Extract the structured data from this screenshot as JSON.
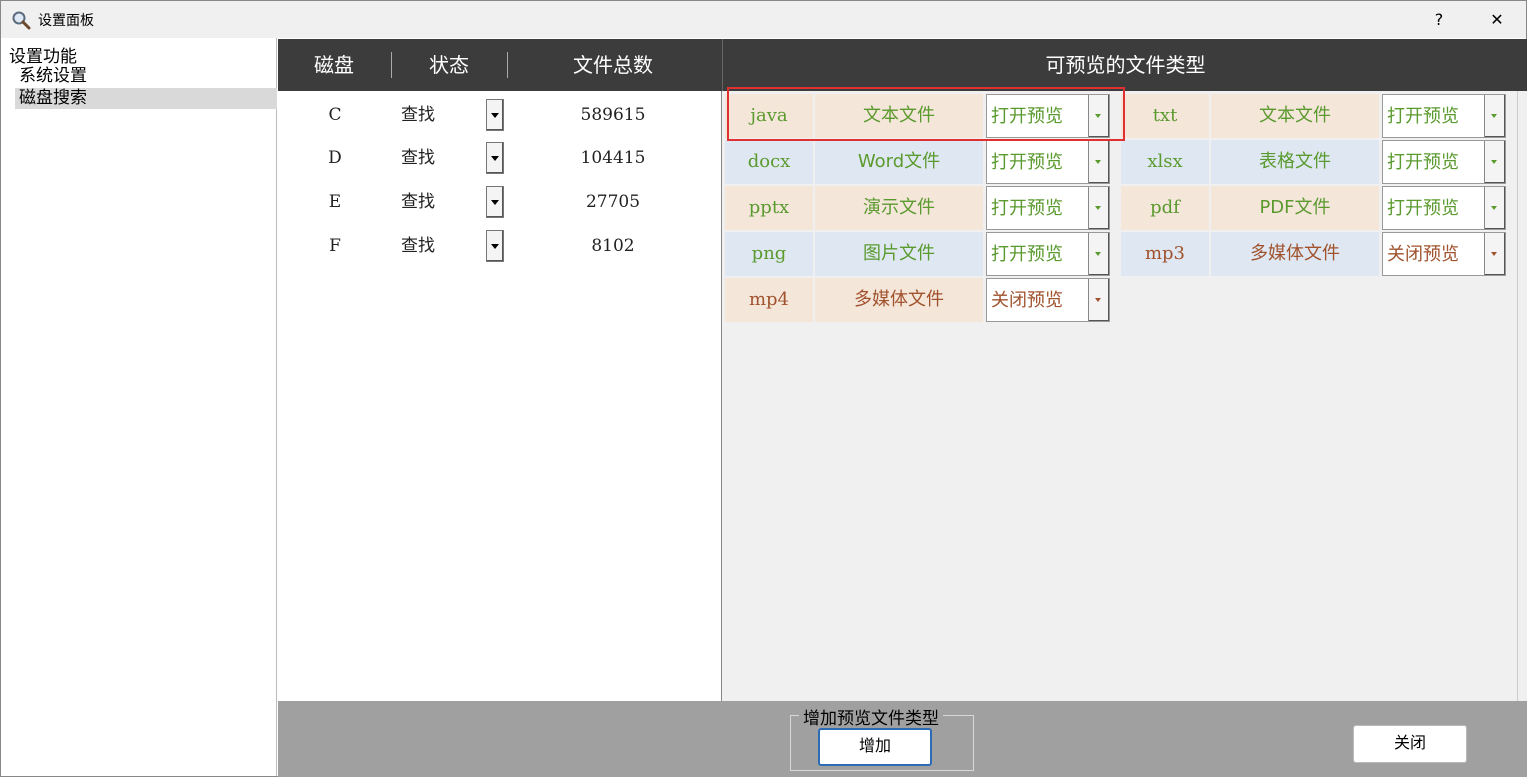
{
  "window": {
    "title": "设置面板",
    "help": "?",
    "close": "✕"
  },
  "sidebar": {
    "root": "设置功能",
    "items": [
      {
        "label": "系统设置",
        "selected": false
      },
      {
        "label": "磁盘搜索",
        "selected": true
      }
    ]
  },
  "disk_table": {
    "headers": [
      "磁盘",
      "状态",
      "文件总数"
    ],
    "rows": [
      {
        "disk": "C",
        "status": "查找",
        "count": "589615"
      },
      {
        "disk": "D",
        "status": "查找",
        "count": "104415"
      },
      {
        "disk": "E",
        "status": "查找",
        "count": "27705"
      },
      {
        "disk": "F",
        "status": "查找",
        "count": "8102"
      }
    ]
  },
  "types_panel": {
    "header": "可预览的文件类型",
    "items": [
      {
        "ext": "java",
        "desc": "文本文件",
        "state": "打开预览",
        "color": "#5a9a2e",
        "bg": "#f5e6da"
      },
      {
        "ext": "txt",
        "desc": "文本文件",
        "state": "打开预览",
        "color": "#5a9a2e",
        "bg": "#f5e6da"
      },
      {
        "ext": "docx",
        "desc": "Word文件",
        "state": "打开预览",
        "color": "#5a9a2e",
        "bg": "#dfe8f2"
      },
      {
        "ext": "xlsx",
        "desc": "表格文件",
        "state": "打开预览",
        "color": "#5a9a2e",
        "bg": "#dfe8f2"
      },
      {
        "ext": "pptx",
        "desc": "演示文件",
        "state": "打开预览",
        "color": "#5a9a2e",
        "bg": "#f5e6da"
      },
      {
        "ext": "pdf",
        "desc": "PDF文件",
        "state": "打开预览",
        "color": "#5a9a2e",
        "bg": "#f5e6da"
      },
      {
        "ext": "png",
        "desc": "图片文件",
        "state": "打开预览",
        "color": "#5a9a2e",
        "bg": "#dfe8f2"
      },
      {
        "ext": "mp3",
        "desc": "多媒体文件",
        "state": "关闭预览",
        "color": "#a0522d",
        "bg": "#dfe8f2"
      },
      {
        "ext": "mp4",
        "desc": "多媒体文件",
        "state": "关闭预览",
        "color": "#a0522d",
        "bg": "#f5e6da"
      }
    ]
  },
  "footer": {
    "group_label": "增加预览文件类型",
    "add_button": "增加",
    "close_button": "关闭"
  }
}
